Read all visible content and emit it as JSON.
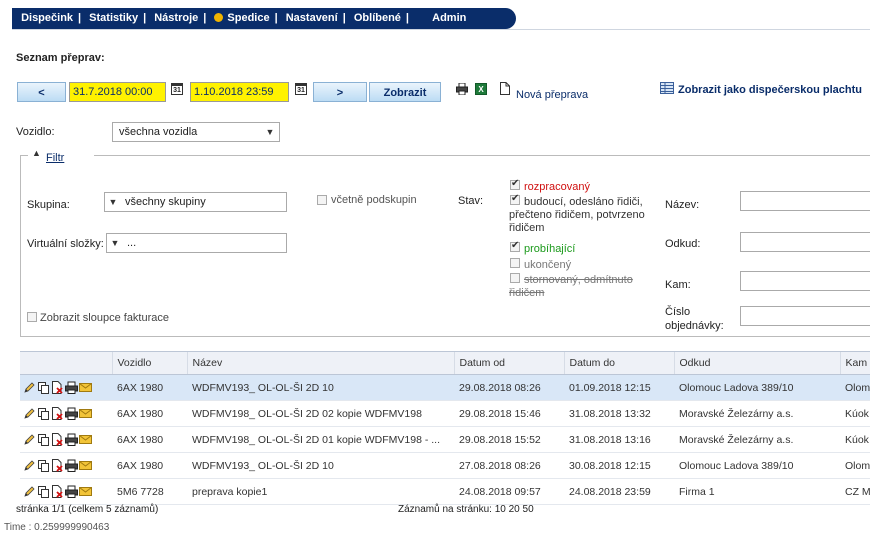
{
  "nav": {
    "items": [
      "Dispečink",
      "Statistiky",
      "Nástroje",
      "Spedice",
      "Nastavení",
      "Oblíbené",
      "Admin"
    ],
    "spedice_dot_color": "#f0b400"
  },
  "heading": "Seznam přeprav:",
  "toolbar": {
    "prev_label": "<",
    "date_from": "31.7.2018 00:00",
    "date_to": "1.10.2018 23:59",
    "cal_label": "31",
    "next_label": ">",
    "show_label": "Zobrazit",
    "new_label": "Nová přeprava",
    "plan_label": "Zobrazit jako dispečerskou plachtu"
  },
  "vehicle": {
    "label": "Vozidlo:",
    "value": "všechna vozidla"
  },
  "filter": {
    "title": "Filtr",
    "group_label": "Skupina:",
    "group_value": "všechny skupiny",
    "subgroups_label": "včetně podskupin",
    "virtual_label": "Virtuální složky:",
    "virtual_value": "...",
    "billing_label": "Zobrazit sloupce fakturace",
    "state_label": "Stav:",
    "states": [
      {
        "text": "rozpracovaný",
        "checked": true,
        "color": "#d01010"
      },
      {
        "text": "budoucí, odesláno řidiči, přečteno řidičem, potvrzeno řidičem",
        "checked": true,
        "color": "#333333"
      },
      {
        "text": "probíhající",
        "checked": true,
        "color": "#1c9a1c"
      },
      {
        "text": "ukončený",
        "checked": false,
        "color": "#777777"
      },
      {
        "text": "stornovaný, odmítnuto řidičem",
        "checked": false,
        "color": "#777777"
      }
    ],
    "name_label": "Název:",
    "from_label": "Odkud:",
    "to_label": "Kam:",
    "order_label": "Číslo objednávky:"
  },
  "table": {
    "headers": [
      "",
      "Vozidlo",
      "Název",
      "Datum od",
      "Datum do",
      "Odkud",
      "Kam"
    ],
    "rows": [
      [
        "6AX 1980",
        "WDFMV193_ OL-OL-ŠI 2D 10",
        "29.08.2018 08:26",
        "01.09.2018 12:15",
        "Olomouc Ladova 389/10",
        "Olom"
      ],
      [
        "6AX 1980",
        "WDFMV198_ OL-OL-ŠI 2D 02 kopie WDFMV198",
        "29.08.2018 15:46",
        "31.08.2018 13:32",
        "Moravské Železárny a.s.",
        "Kúok"
      ],
      [
        "6AX 1980",
        "WDFMV198_ OL-OL-ŠI 2D 01 kopie WDFMV198 - ...",
        "29.08.2018 15:52",
        "31.08.2018 13:16",
        "Moravské Železárny a.s.",
        "Kúok"
      ],
      [
        "6AX 1980",
        "WDFMV193_ OL-OL-ŠI 2D 10",
        "27.08.2018 08:26",
        "30.08.2018 12:15",
        "Olomouc Ladova 389/10",
        "Olom"
      ],
      [
        "5M6 7728",
        "preprava kopie1",
        "24.08.2018 09:57",
        "24.08.2018 23:59",
        "Firma 1",
        "CZ M"
      ]
    ]
  },
  "pager": {
    "page_info": "stránka 1/1 (celkem 5 záznamů)",
    "per_page": "Záznamů na stránku: 10 20 50"
  },
  "time": "Time : 0.259999990463"
}
